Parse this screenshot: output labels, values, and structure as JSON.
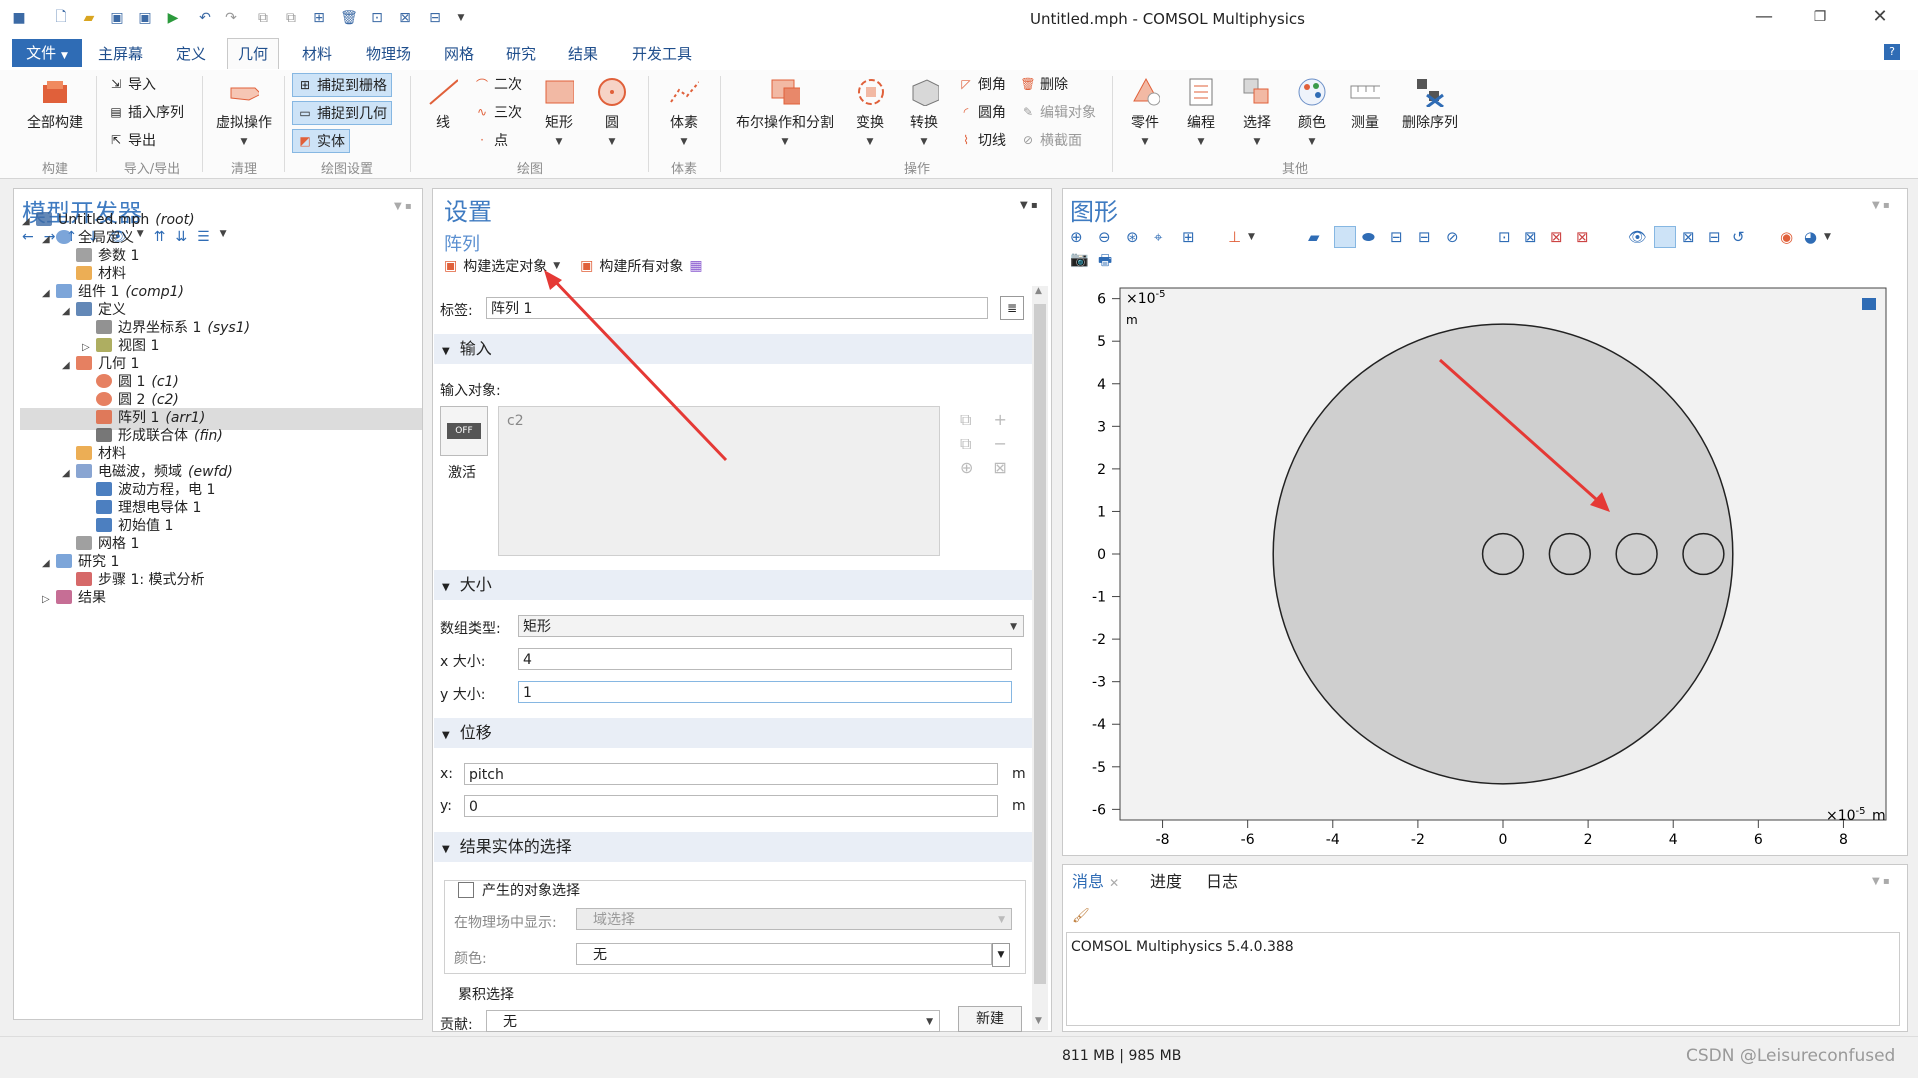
{
  "window": {
    "title": "Untitled.mph - COMSOL Multiphysics"
  },
  "menu": {
    "file": "文件",
    "tabs": [
      "主屏幕",
      "定义",
      "几何",
      "材料",
      "物理场",
      "网格",
      "研究",
      "结果",
      "开发工具"
    ],
    "active_tab": "几何"
  },
  "ribbon": {
    "build_all": "全部构建",
    "import": "导入",
    "insert_sequence": "插入序列",
    "export": "导出",
    "virtual_ops": "虚拟操作",
    "snap_grid": "捕捉到栅格",
    "snap_geometry": "捕捉到几何",
    "solid": "实体",
    "line": "线",
    "quadratic": "二次",
    "cubic": "三次",
    "point": "点",
    "rectangle": "矩形",
    "circle": "圆",
    "solids": "体素",
    "boolean": "布尔操作和分割",
    "transforms": "变换",
    "conversions": "转换",
    "chamfer": "倒角",
    "fillet": "圆角",
    "tangent": "切线",
    "delete": "删除",
    "edit_object": "编辑对象",
    "cross_section": "横截面",
    "parts": "零件",
    "program": "编程",
    "selections": "选择",
    "colors": "颜色",
    "measure": "测量",
    "delete_sequence": "删除序列",
    "groups": [
      "构建",
      "导入/导出",
      "清理",
      "绘图设置",
      "绘图",
      "体素",
      "操作",
      "其他"
    ]
  },
  "model_builder": {
    "title": "模型开发器",
    "tree": [
      {
        "label": "Untitled.mph",
        "tag": "(root)",
        "level": 0,
        "icon": "file-icon"
      },
      {
        "label": "全局定义",
        "tag": "",
        "level": 1,
        "icon": "globe-icon"
      },
      {
        "label": "参数 1",
        "tag": "",
        "level": 2,
        "icon": "param-icon"
      },
      {
        "label": "材料",
        "tag": "",
        "level": 2,
        "icon": "materials-icon"
      },
      {
        "label": "组件 1",
        "tag": "(comp1)",
        "level": 1,
        "icon": "component-icon"
      },
      {
        "label": "定义",
        "tag": "",
        "level": 2,
        "icon": "definitions-icon"
      },
      {
        "label": "边界坐标系 1",
        "tag": "(sys1)",
        "level": 3,
        "icon": "coordsys-icon"
      },
      {
        "label": "视图 1",
        "tag": "",
        "level": 3,
        "icon": "view-icon"
      },
      {
        "label": "几何 1",
        "tag": "",
        "level": 2,
        "icon": "geometry-icon"
      },
      {
        "label": "圆 1",
        "tag": "(c1)",
        "level": 3,
        "icon": "circle-icon"
      },
      {
        "label": "圆 2",
        "tag": "(c2)",
        "level": 3,
        "icon": "circle-icon"
      },
      {
        "label": "阵列 1",
        "tag": "(arr1)",
        "level": 3,
        "icon": "array-icon"
      },
      {
        "label": "形成联合体",
        "tag": "(fin)",
        "level": 3,
        "icon": "form-union-icon"
      },
      {
        "label": "材料",
        "tag": "",
        "level": 2,
        "icon": "materials-icon"
      },
      {
        "label": "电磁波，频域",
        "tag": "(ewfd)",
        "level": 2,
        "icon": "physics-icon"
      },
      {
        "label": "波动方程，电 1",
        "tag": "",
        "level": 3,
        "icon": "domain-icon"
      },
      {
        "label": "理想电导体 1",
        "tag": "",
        "level": 3,
        "icon": "boundary-icon"
      },
      {
        "label": "初始值 1",
        "tag": "",
        "level": 3,
        "icon": "domain-icon"
      },
      {
        "label": "网格 1",
        "tag": "",
        "level": 2,
        "icon": "mesh-icon"
      },
      {
        "label": "研究 1",
        "tag": "",
        "level": 1,
        "icon": "study-icon"
      },
      {
        "label": "步骤 1: 模式分析",
        "tag": "",
        "level": 2,
        "icon": "step-icon"
      },
      {
        "label": "结果",
        "tag": "",
        "level": 1,
        "icon": "results-icon"
      }
    ]
  },
  "settings": {
    "title": "设置",
    "subtitle": "阵列",
    "build_selected": "构建选定对象",
    "build_all": "构建所有对象",
    "label_caption": "标签:",
    "label_value": "阵列 1",
    "input_section": "输入",
    "input_objects_caption": "输入对象:",
    "input_objects": [
      "c2"
    ],
    "activate_toggle": "OFF",
    "activate_label": "激活",
    "size_section": "大小",
    "array_type_caption": "数组类型:",
    "array_type_value": "矩形",
    "x_size_caption": "x 大小:",
    "x_size_value": "4",
    "y_size_caption": "y 大小:",
    "y_size_value": "1",
    "displacement_section": "位移",
    "x_caption": "x:",
    "x_value": "pitch",
    "y_caption": "y:",
    "y_value": "0",
    "unit": "m",
    "selections_section": "结果实体的选择",
    "resulting_selection_label": "产生的对象选择",
    "show_in_physics_caption": "在物理场中显示:",
    "show_in_physics_value": "域选择",
    "color_caption": "颜色:",
    "color_value": "无",
    "cumulative_caption": "累积选择",
    "contribute_caption": "贡献:",
    "contribute_value": "无",
    "new_button": "新建"
  },
  "graphics": {
    "title": "图形",
    "x_scale_label": "×10",
    "x_scale_exp": "-5",
    "x_unit": "m",
    "y_scale_label": "×10",
    "y_scale_exp": "-5",
    "y_unit": "m",
    "x_ticks": [
      "-8",
      "-6",
      "-4",
      "-2",
      "0",
      "2",
      "4",
      "6",
      "8"
    ],
    "y_ticks": [
      "6",
      "5",
      "4",
      "3",
      "2",
      "1",
      "0",
      "-1",
      "-2",
      "-3",
      "-4",
      "-5",
      "-6"
    ],
    "geometry": {
      "big_circle": {
        "cx": 0,
        "cy": 0,
        "r": 5.4
      },
      "small_circles_x": [
        0,
        1.57,
        3.14,
        4.71
      ],
      "small_r": 0.48
    },
    "background": "#f2f2f2",
    "fill": "#cfcfcf"
  },
  "messages": {
    "tabs": [
      "消息",
      "进度",
      "日志"
    ],
    "text": "COMSOL Multiphysics 5.4.0.388"
  },
  "status": {
    "memory": "811 MB | 985 MB"
  },
  "watermark": "CSDN @Leisureconfused",
  "colors": {
    "accent": "#2f6cb5",
    "heading": "#3f7bc1",
    "arrow": "#e53935",
    "selected_row": "#dcdcdc"
  }
}
